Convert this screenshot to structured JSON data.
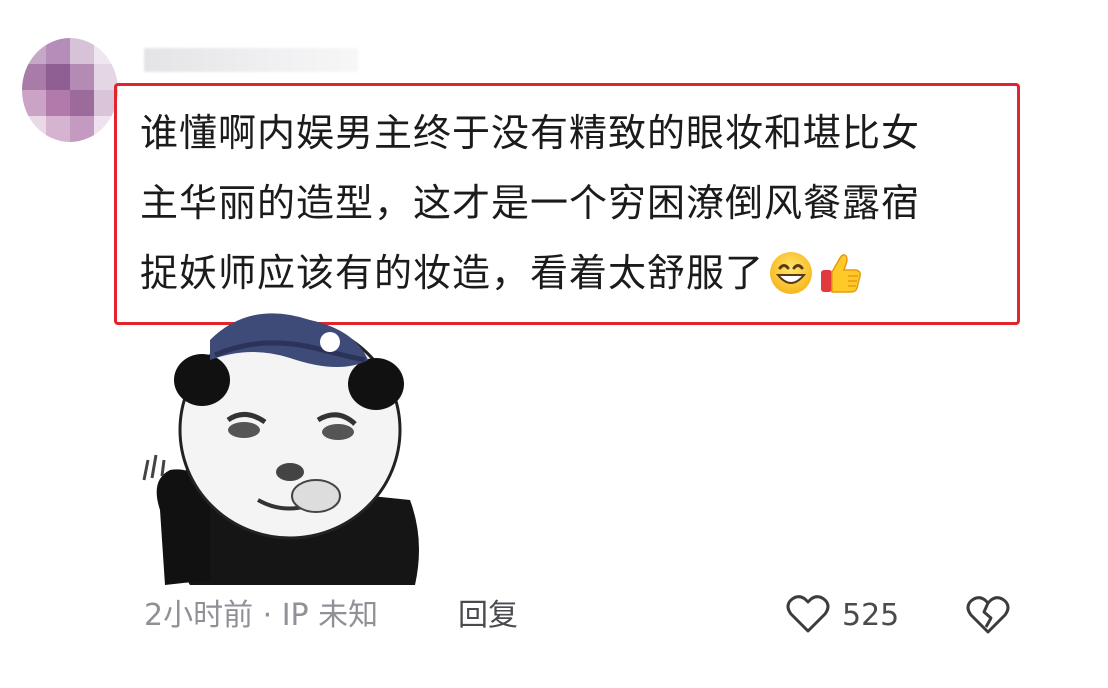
{
  "comment": {
    "text_line1": "谁懂啊内娱男主终于没有精致的眼妆和堪比女",
    "text_line2": "主华丽的造型，这才是一个穷困潦倒风餐露宿",
    "text_line3": "捉妖师应该有的妆造，看着太舒服了",
    "emojis": [
      "grinning-face-icon",
      "thumbs-up-icon"
    ],
    "highlight_color": "#e2242c"
  },
  "meta": {
    "time_location": "2小时前 · IP 未知",
    "reply_label": "回复",
    "like_count": "525"
  },
  "icons": {
    "like": "heart-outline-icon",
    "dislike": "broken-heart-icon"
  }
}
